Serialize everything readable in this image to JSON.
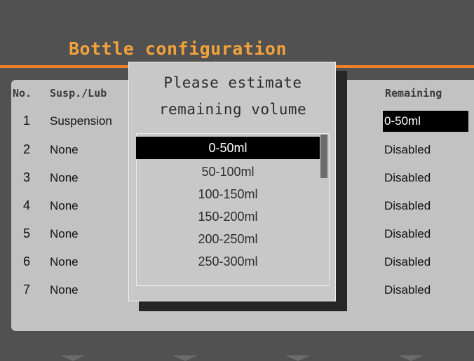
{
  "screen": {
    "title": "Bottle configuration"
  },
  "table": {
    "headers": {
      "no": "No.",
      "type": "Susp./Lub",
      "remaining": "Remaining"
    },
    "rows": [
      {
        "no": "1",
        "type": "Suspension",
        "remaining": "0-50ml",
        "selected": true
      },
      {
        "no": "2",
        "type": "None",
        "remaining": "Disabled"
      },
      {
        "no": "3",
        "type": "None",
        "remaining": "Disabled"
      },
      {
        "no": "4",
        "type": "None",
        "remaining": "Disabled"
      },
      {
        "no": "5",
        "type": "None",
        "remaining": "Disabled"
      },
      {
        "no": "6",
        "type": "None",
        "remaining": "Disabled"
      },
      {
        "no": "7",
        "type": "None",
        "remaining": "Disabled"
      }
    ]
  },
  "dialog": {
    "title_line1": "Please estimate",
    "title_line2": "remaining volume",
    "options": [
      "0-50ml",
      "50-100ml",
      "100-150ml",
      "150-200ml",
      "200-250ml",
      "250-300ml"
    ],
    "selected_option": "0-50ml"
  },
  "softkeys": [
    "softkey-arrow-icon",
    "softkey-arrow-icon",
    "softkey-arrow-icon",
    "softkey-arrow-icon"
  ]
}
